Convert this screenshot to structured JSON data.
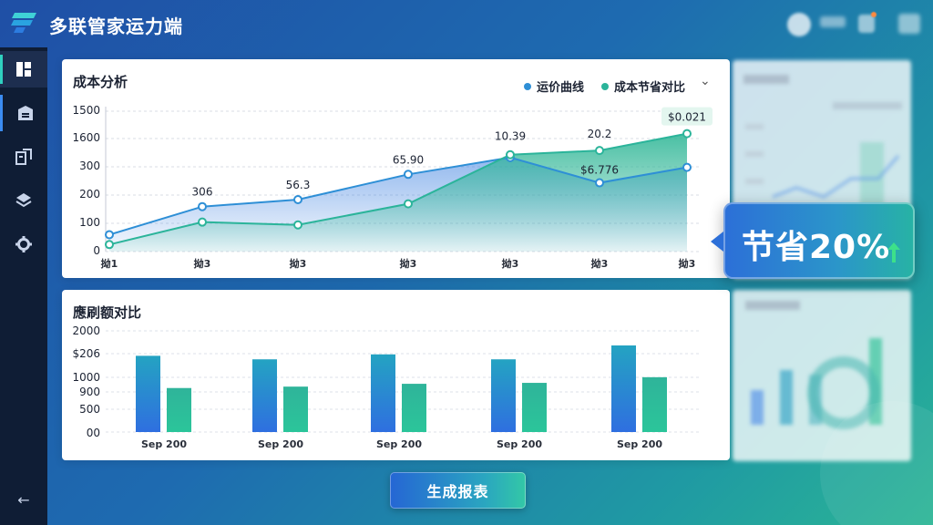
{
  "app": {
    "title": "多联管家运力端"
  },
  "sidebar": {
    "items": [
      {
        "icon": "dashboard-icon",
        "active": true
      },
      {
        "icon": "warehouse-icon",
        "active": false
      },
      {
        "icon": "document-icon",
        "active": false
      },
      {
        "icon": "layers-icon",
        "active": false
      },
      {
        "icon": "gear-icon",
        "active": false
      }
    ],
    "collapse_icon": "collapse-arrow-icon",
    "collapse_glyph": "←"
  },
  "cost_card": {
    "title": "成本分析",
    "legend": [
      {
        "label": "运价曲线",
        "color": "#2e8fd6"
      },
      {
        "label": "成本节省对比",
        "color": "#2bb49a"
      }
    ],
    "dropdown_glyph": "⌄",
    "point_labels": [
      "306",
      "56.3",
      "65.90",
      "10.39",
      "20.2",
      "$6.776",
      "$0.021"
    ]
  },
  "bar_card": {
    "title": "應刷额对比"
  },
  "chart_data": [
    {
      "type": "area",
      "title": "成本分析",
      "y_ticks": [
        "1500",
        "1600",
        "300",
        "200",
        "100",
        "0"
      ],
      "x_ticks": [
        "拗1",
        "拗3",
        "拗3",
        "拗3",
        "拗3",
        "拗3",
        "拗3"
      ],
      "series": [
        {
          "name": "运价曲线",
          "color": "#2e8fd6",
          "values": [
            60,
            160,
            185,
            275,
            335,
            245,
            300
          ]
        },
        {
          "name": "成本节省对比",
          "color": "#2bb49a",
          "values": [
            25,
            105,
            95,
            170,
            345,
            360,
            420
          ]
        }
      ],
      "ylim": [
        0,
        500
      ],
      "grid": true,
      "legend_position": "top-right"
    },
    {
      "type": "bar",
      "title": "應刷额对比",
      "y_ticks": [
        "2000",
        "$206",
        "1000",
        "900",
        "500",
        "00"
      ],
      "categories": [
        "Sep 200",
        "Sep 200",
        "Sep 200",
        "Sep 200",
        "Sep 200"
      ],
      "series": [
        {
          "color": "#2e8fd6",
          "values": [
            1620,
            1545,
            1650,
            1545,
            1840
          ]
        },
        {
          "color": "#2bb49a",
          "values": [
            935,
            965,
            1025,
            1045,
            1165
          ]
        }
      ],
      "ylim": [
        0,
        2150
      ],
      "grid": true
    }
  ],
  "highlight": {
    "text": "节省20%"
  },
  "actions": {
    "generate_report": "生成报表"
  }
}
